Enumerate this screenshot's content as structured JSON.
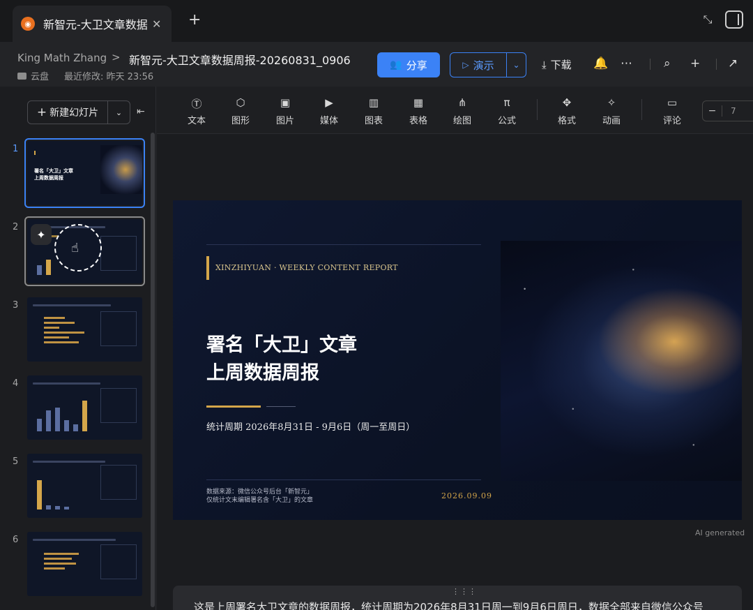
{
  "tab": {
    "title": "新智元-大卫文章数据",
    "close": "✕",
    "new": "+"
  },
  "header": {
    "breadcrumb_root": "King Math Zhang",
    "breadcrumb_sep": ">",
    "doc_title": "新智元-大卫文章数据周报-20260831_0906",
    "folder": "云盘",
    "last_modified": "最近修改: 昨天 23:56",
    "share_label": "分享",
    "present_label": "演示",
    "download_label": "下载"
  },
  "sidebar": {
    "new_slide_label": "新建幻灯片",
    "slides": [
      {
        "num": "1",
        "title_line1": "署名「大卫」文章",
        "title_line2": "上周数据周报"
      },
      {
        "num": "2"
      },
      {
        "num": "3"
      },
      {
        "num": "4"
      },
      {
        "num": "5"
      },
      {
        "num": "6"
      }
    ]
  },
  "toolbar": {
    "items": [
      "文本",
      "图形",
      "图片",
      "媒体",
      "图表",
      "表格",
      "绘图",
      "公式",
      "格式",
      "动画",
      "评论"
    ],
    "zoom_minus": "−",
    "zoom_value": "7"
  },
  "slide": {
    "kicker": "XINZHIYUAN · WEEKLY CONTENT REPORT",
    "title_line1": "署名「大卫」文章",
    "title_line2": "上周数据周报",
    "period": "统计周期 2026年8月31日 - 9月6日（周一至周日）",
    "source_line1": "数据来源：微信公众号后台「新智元」",
    "source_line2": "仅统计文末编辑署名含「大卫」的文章",
    "date": "2026.09.09",
    "ai_generated": "AI generated"
  },
  "notes": {
    "grip": "⋮⋮⋮",
    "text": "这是上周署名大卫文章的数据周报，统计周期为2026年8月31日周一到9月6日周日，数据全部来自微信公众号"
  }
}
